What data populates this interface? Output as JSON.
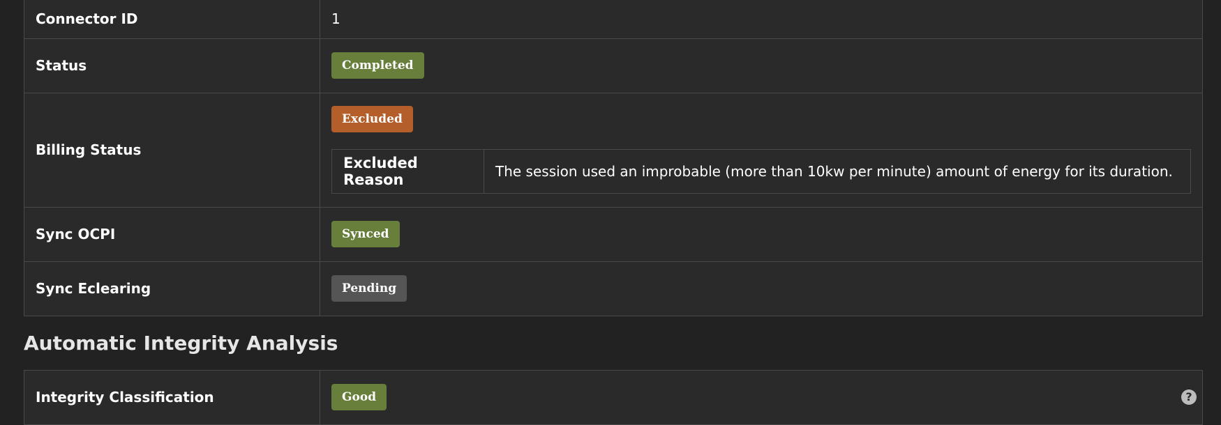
{
  "details": {
    "connector_id": {
      "label": "Connector ID",
      "value": "1"
    },
    "status": {
      "label": "Status",
      "badge": "Completed"
    },
    "billing_status": {
      "label": "Billing Status",
      "badge": "Excluded",
      "excluded_reason_label": "Excluded Reason",
      "excluded_reason_value": "The session used an improbable (more than 10kw per minute) amount of energy for its duration."
    },
    "sync_ocpi": {
      "label": "Sync OCPI",
      "badge": "Synced"
    },
    "sync_eclearing": {
      "label": "Sync Eclearing",
      "badge": "Pending"
    }
  },
  "integrity": {
    "title": "Automatic Integrity Analysis",
    "classification_label": "Integrity Classification",
    "classification_badge": "Good",
    "help_icon": "question-circle-icon"
  },
  "colors": {
    "success": "#677f3b",
    "warning": "#b45e2a",
    "secondary": "#555555",
    "background": "#222222",
    "panel": "#2a2a2a"
  }
}
